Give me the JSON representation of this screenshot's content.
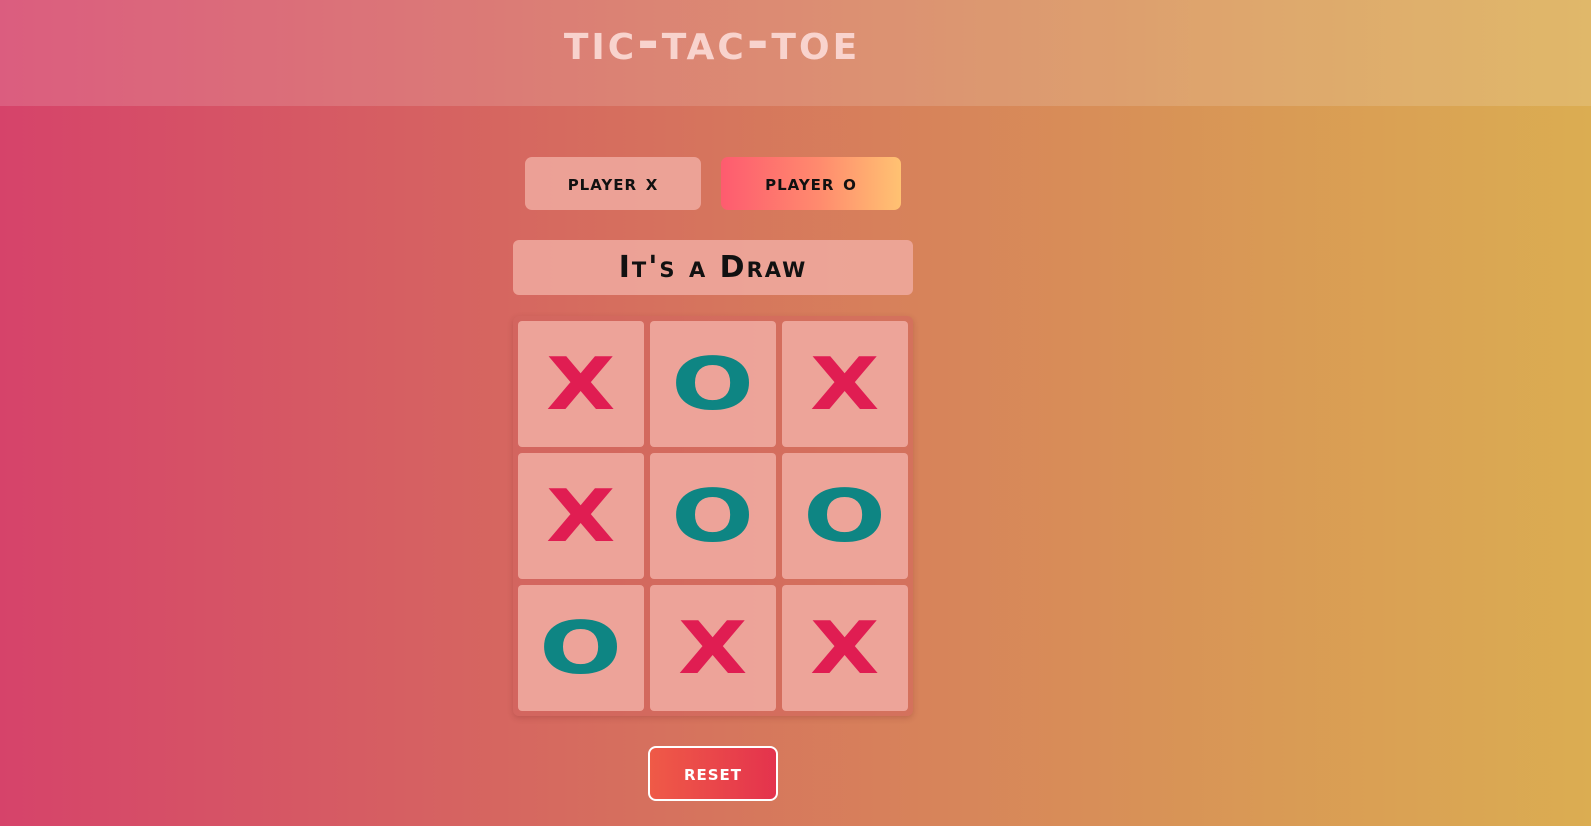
{
  "header": {
    "title": "Tic-Tac-Toe"
  },
  "players": [
    {
      "label": "Player X",
      "active": false
    },
    {
      "label": "Player O",
      "active": true
    }
  ],
  "status": "It's a Draw",
  "board": {
    "cells": [
      "X",
      "O",
      "X",
      "X",
      "O",
      "O",
      "O",
      "X",
      "X"
    ]
  },
  "controls": {
    "reset_label": "Reset"
  },
  "colors": {
    "x_mark": "#e01d52",
    "o_mark": "#0e8583",
    "active_player_gradient_start": "#fe5b6f",
    "active_player_gradient_end": "#ffc272"
  }
}
